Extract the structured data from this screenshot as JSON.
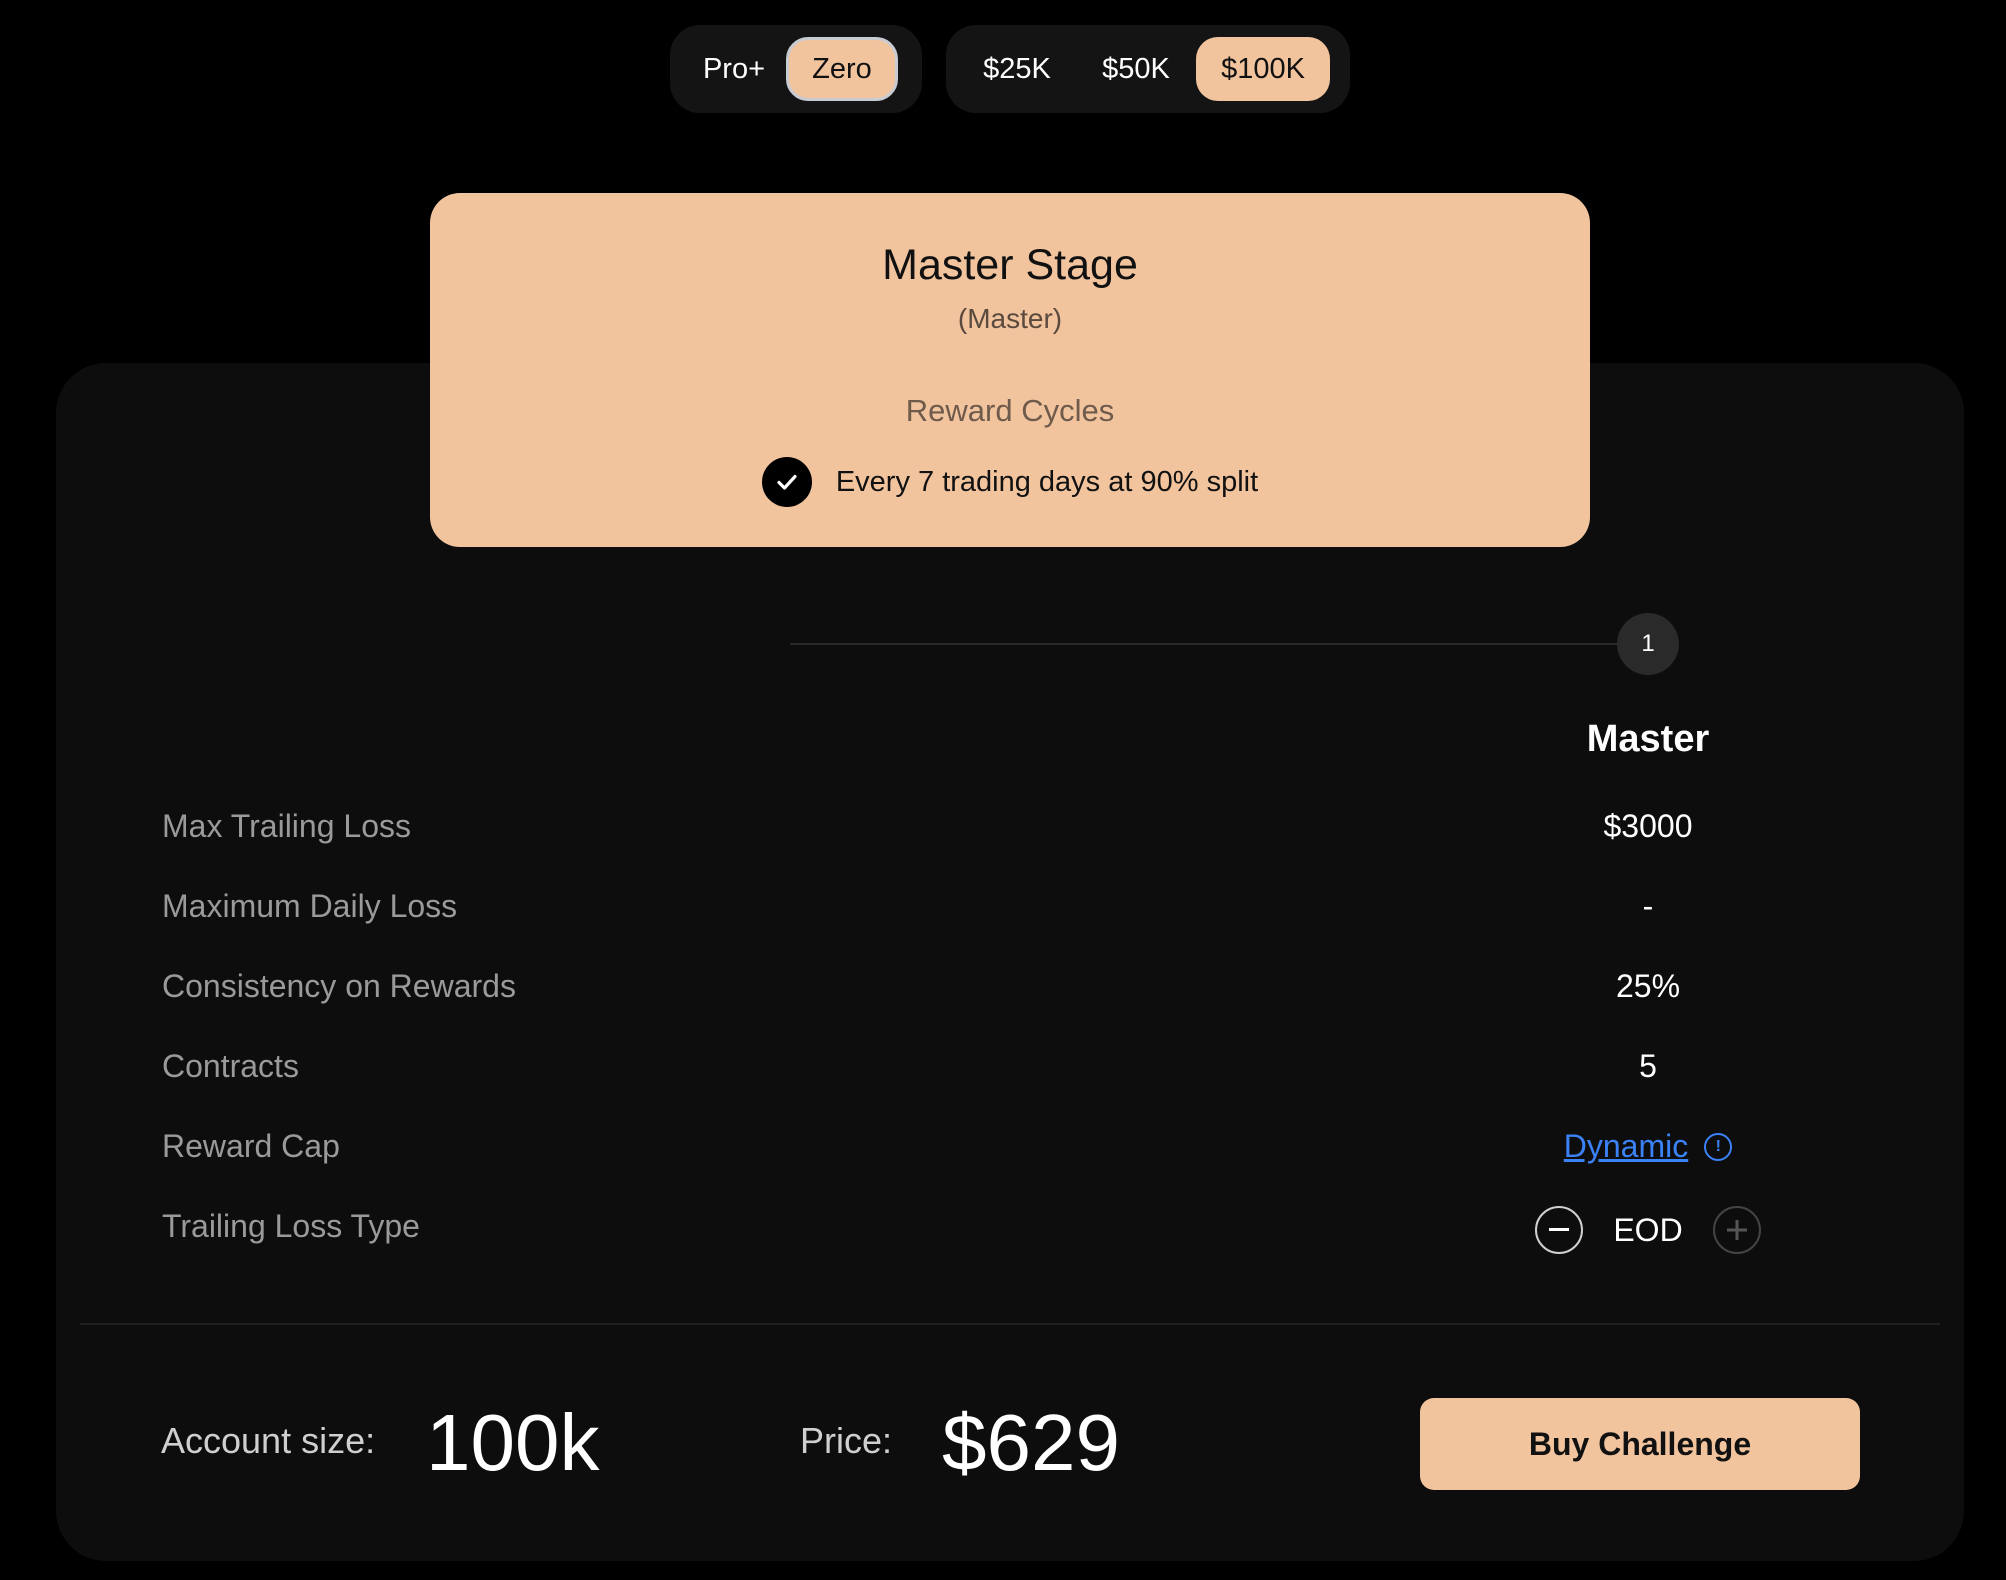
{
  "plan_toggle": {
    "options": [
      "Pro+",
      "Zero"
    ],
    "selected": "Zero"
  },
  "size_toggle": {
    "options": [
      "$25K",
      "$50K",
      "$100K"
    ],
    "selected": "$100K"
  },
  "stage_card": {
    "title": "Master Stage",
    "subtitle": "(Master)",
    "cycles_heading": "Reward Cycles",
    "cycle_text": "Every 7 trading days at 90% split"
  },
  "progress": {
    "step": "1"
  },
  "column_header": "Master",
  "rows": [
    {
      "label": "Max Trailing Loss",
      "value": "$3000"
    },
    {
      "label": "Maximum Daily Loss",
      "value": "-"
    },
    {
      "label": "Consistency on Rewards",
      "value": "25%"
    },
    {
      "label": "Contracts",
      "value": "5"
    },
    {
      "label": "Reward Cap",
      "value": "Dynamic"
    },
    {
      "label": "Trailing Loss Type",
      "value": "EOD"
    }
  ],
  "footer": {
    "account_label": "Account size:",
    "account_value": "100k",
    "price_label": "Price:",
    "price_value": "$629",
    "buy_label": "Buy Challenge"
  },
  "colors": {
    "accent": "#f2c49e",
    "link": "#3b82f6",
    "background": "#000000",
    "panel": "#0d0d0d"
  },
  "icons": {
    "check": "check-icon",
    "info": "info-icon",
    "minus": "minus-icon",
    "plus": "plus-icon"
  }
}
